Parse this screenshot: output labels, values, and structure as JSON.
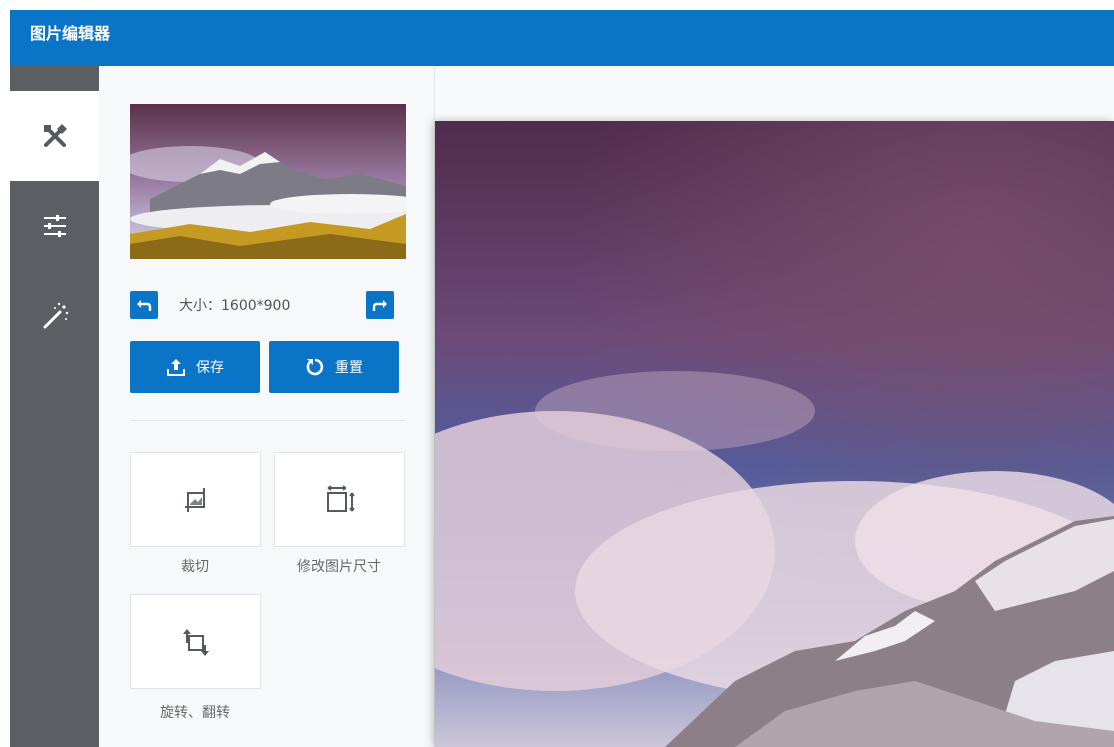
{
  "app": {
    "title": "图片编辑器"
  },
  "rail": {
    "items": [
      {
        "icon": "tools-icon",
        "active": true
      },
      {
        "icon": "sliders-icon",
        "active": false
      },
      {
        "icon": "magic-wand-icon",
        "active": false
      }
    ]
  },
  "panel": {
    "size_text": "大小：1600*900",
    "undo_icon": "undo-icon",
    "redo_icon": "redo-icon",
    "save_label": "保存",
    "reset_label": "重置",
    "tools": [
      {
        "label": "裁切",
        "icon": "crop-icon"
      },
      {
        "label": "修改图片尺寸",
        "icon": "resize-icon"
      },
      {
        "label": "旋转、翻转",
        "icon": "rotate-flip-icon"
      }
    ]
  },
  "colors": {
    "brand_blue": "#0a74c7",
    "rail_gray": "#5b5f63",
    "panel_bg": "#f7f8f9"
  }
}
